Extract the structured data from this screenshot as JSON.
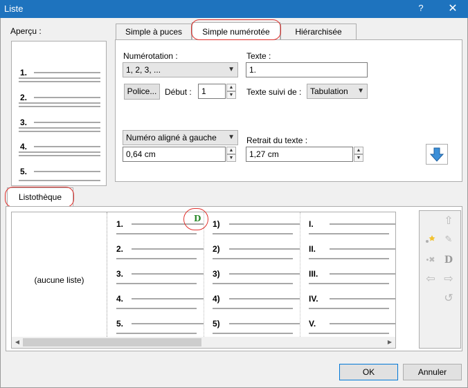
{
  "window": {
    "title": "Liste",
    "help_glyph": "?",
    "close_glyph": "✕"
  },
  "preview": {
    "label": "Aperçu :",
    "items": [
      "1.",
      "2.",
      "3.",
      "4.",
      "5."
    ]
  },
  "tabs": [
    {
      "label": "Simple à puces",
      "active": false
    },
    {
      "label": "Simple numérotée",
      "active": true
    },
    {
      "label": "Hiérarchisée",
      "active": false
    }
  ],
  "form": {
    "numbering_label": "Numérotation :",
    "numbering_value": "1, 2, 3, ...",
    "text_label": "Texte :",
    "text_value": "1.",
    "font_button": "Police...",
    "start_label": "Début :",
    "start_value": "1",
    "followed_label": "Texte suivi de :",
    "followed_value": "Tabulation",
    "alignment_value": "Numéro aligné à gauche",
    "alignment_indent": "0,64 cm",
    "indent_label": "Retrait du texte :",
    "indent_value": "1,27 cm"
  },
  "library": {
    "tab_label": "Listothèque",
    "none_label": "(aucune liste)",
    "columns": [
      [
        "1.",
        "2.",
        "3.",
        "4.",
        "5."
      ],
      [
        "1)",
        "2)",
        "3)",
        "4)",
        "5)"
      ],
      [
        "I.",
        "II.",
        "III.",
        "IV.",
        "V."
      ]
    ],
    "default_marker": "D"
  },
  "buttons": {
    "ok": "OK",
    "cancel": "Annuler"
  },
  "colors": {
    "titlebar": "#1e73be",
    "highlight": "#e0312d",
    "default_marker": "#2a8a2a",
    "accent_blue": "#3b8fd8"
  }
}
